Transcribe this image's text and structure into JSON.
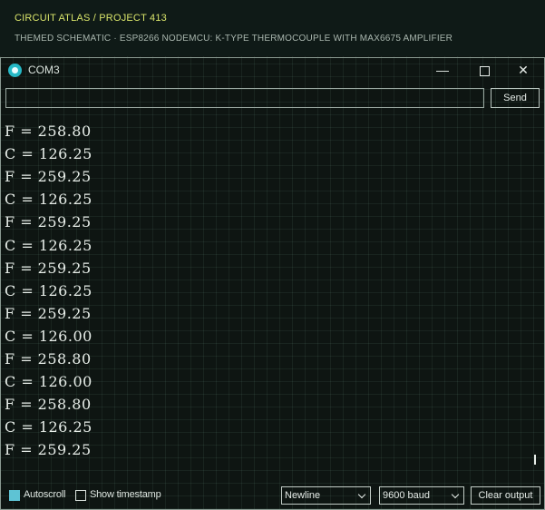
{
  "banner": {
    "title": "CIRCUIT ATLAS / PROJECT 413",
    "subtitle": "THEMED SCHEMATIC · ESP8266 NODEMCU: K-TYPE THERMOCOUPLE WITH MAX6675 AMPLIFIER"
  },
  "window": {
    "title": "COM3",
    "icon": "serial-monitor-icon",
    "controls": {
      "minimize": "—",
      "maximize": "",
      "close": "✕"
    }
  },
  "send": {
    "input_value": "",
    "button_label": "Send"
  },
  "output": {
    "lines": [
      "F = 258.80",
      "C = 126.25",
      "F = 259.25",
      "C = 126.25",
      "F = 259.25",
      "C = 126.25",
      "F = 259.25",
      "C = 126.25",
      "F = 259.25",
      "C = 126.00",
      "F = 258.80",
      "C = 126.00",
      "F = 258.80",
      "C = 126.25",
      "F = 259.25"
    ]
  },
  "status": {
    "autoscroll_label": "Autoscroll",
    "autoscroll_checked": true,
    "timestamp_label": "Show timestamp",
    "timestamp_checked": false,
    "line_ending": "Newline",
    "baud": "9600 baud",
    "clear_label": "Clear output"
  },
  "colors": {
    "background": "#0e1512",
    "accent": "#5ec3d4",
    "banner_title": "#d8e36a",
    "text": "#e8eee9"
  }
}
